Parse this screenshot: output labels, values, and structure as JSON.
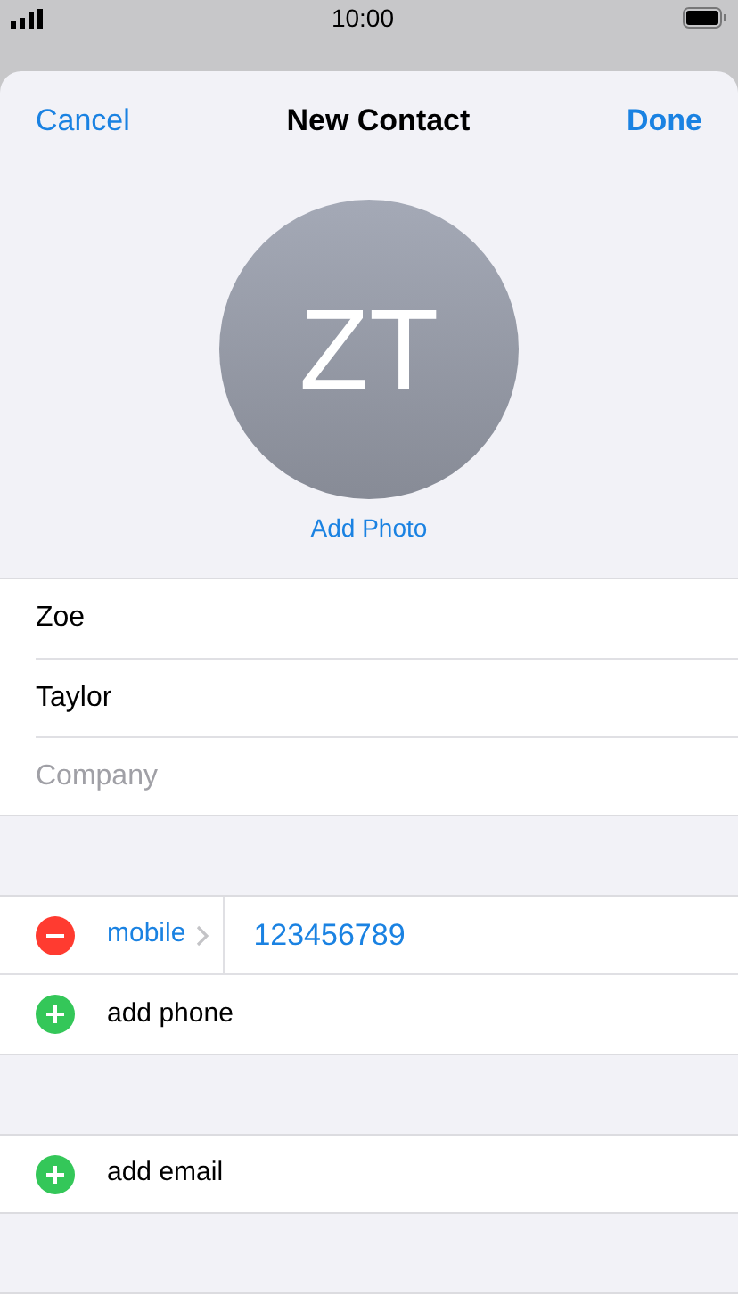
{
  "status_bar": {
    "time": "10:00"
  },
  "nav": {
    "cancel": "Cancel",
    "title": "New Contact",
    "done": "Done"
  },
  "avatar": {
    "initials": "ZT",
    "action": "Add Photo"
  },
  "name_fields": [
    {
      "value": "Zoe"
    },
    {
      "value": "Taylor"
    },
    {
      "placeholder": "Company"
    }
  ],
  "phones": [
    {
      "label": "mobile",
      "number": "123456789"
    }
  ],
  "add_phone": "add phone",
  "add_email": "add email"
}
